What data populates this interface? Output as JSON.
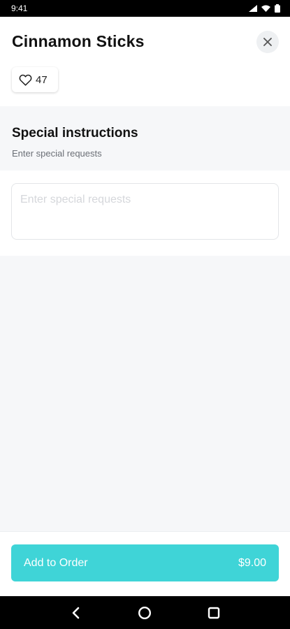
{
  "status_bar": {
    "time": "9:41"
  },
  "header": {
    "title": "Cinnamon Sticks",
    "like_count": "47"
  },
  "special_instructions": {
    "title": "Special instructions",
    "subtitle": "Enter special requests",
    "placeholder": "Enter special requests",
    "value": ""
  },
  "footer": {
    "button_label": "Add to Order",
    "price": "$9.00"
  },
  "icons": {
    "close": "close-icon",
    "like": "heart-icon",
    "back": "back-icon",
    "home": "home-icon",
    "recents": "recents-icon"
  },
  "colors": {
    "accent": "#3fd4d7",
    "background": "#f6f7f9"
  }
}
